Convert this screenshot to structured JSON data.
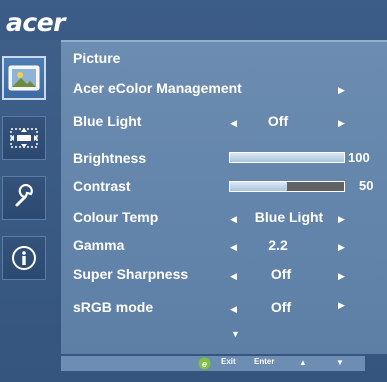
{
  "brand": {
    "logo_text": "acer"
  },
  "rail": {
    "items": [
      {
        "name": "picture-icon",
        "active": true
      },
      {
        "name": "display-position-icon",
        "active": false
      },
      {
        "name": "settings-icon",
        "active": false
      },
      {
        "name": "info-icon",
        "active": false
      }
    ]
  },
  "menu": {
    "title": "Picture",
    "items": [
      {
        "label": "Acer eColor Management",
        "type": "submenu"
      },
      {
        "label": "Blue Light",
        "type": "select",
        "value": "Off"
      },
      {
        "label": "Brightness",
        "type": "slider",
        "value": 100,
        "fill": 1.0
      },
      {
        "label": "Contrast",
        "type": "slider",
        "value": 50,
        "fill": 0.5
      },
      {
        "label": "Colour Temp",
        "type": "select",
        "value": "Blue Light"
      },
      {
        "label": "Gamma",
        "type": "select",
        "value": "2.2"
      },
      {
        "label": "Super Sharpness",
        "type": "select",
        "value": "Off"
      },
      {
        "label": "sRGB mode",
        "type": "select",
        "value": "Off"
      }
    ],
    "scroll_hint": "more-below-arrow"
  },
  "footer": {
    "exit_label": "Exit",
    "enter_label": "Enter",
    "icons": [
      "eco-e-icon",
      "up-arrow-icon",
      "down-arrow-icon"
    ]
  },
  "colors": {
    "background": "#3a5a84",
    "panel": "#6c8cb1",
    "active_tab": "#4f7cb3",
    "text": "#ffffff",
    "slider_track": "#5f6266"
  }
}
